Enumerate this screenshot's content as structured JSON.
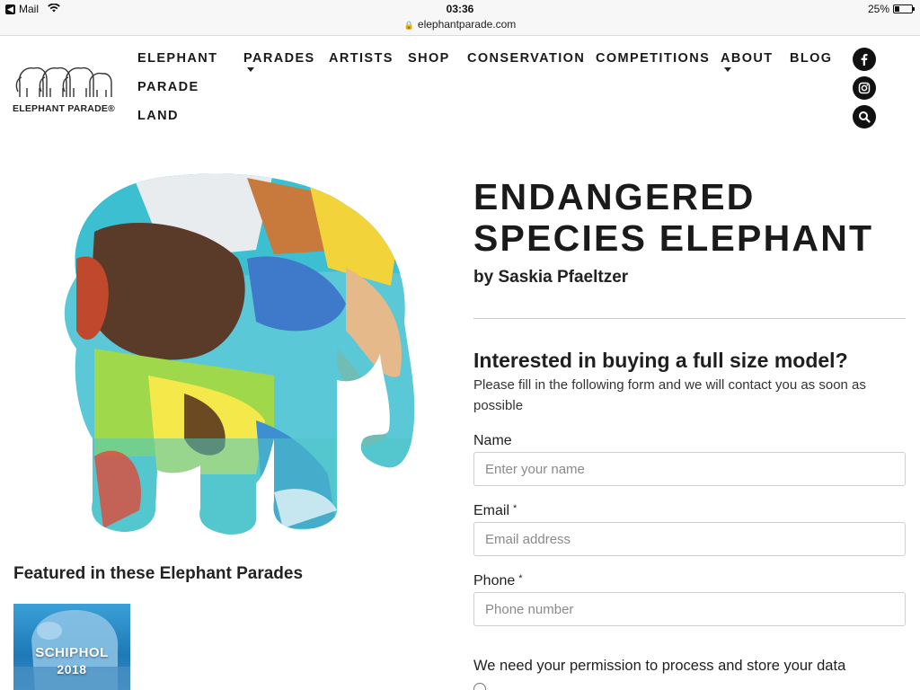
{
  "statusbar": {
    "back_app": "Mail",
    "time": "03:36",
    "url": "elephantparade.com",
    "battery": "25%",
    "battery_level": 0.25
  },
  "logo": {
    "text": "ELEPHANT PARADE®"
  },
  "nav": {
    "items": [
      {
        "label": "ELEPHANT",
        "caret": false
      },
      {
        "label": "PARADE",
        "caret": false
      },
      {
        "label": "LAND",
        "caret": false
      },
      {
        "label": "PARADES",
        "caret": true
      },
      {
        "label": "ARTISTS",
        "caret": false
      },
      {
        "label": "SHOP",
        "caret": false
      },
      {
        "label": "CONSERVATION",
        "caret": false
      },
      {
        "label": "COMPETITIONS",
        "caret": false
      },
      {
        "label": "ABOUT",
        "caret": true
      },
      {
        "label": "BLOG",
        "caret": false
      }
    ]
  },
  "social": {
    "facebook_icon": "f",
    "instagram_icon": "instagram",
    "search_icon": "search"
  },
  "product": {
    "title_line1": "ENDANGERED",
    "title_line2": "SPECIES ELEPHANT",
    "artist": "by Saskia Pfaeltzer"
  },
  "featured": {
    "title": "Featured in these Elephant Parades",
    "parade_line1": "SCHIPHOL",
    "parade_line2": "2018"
  },
  "form": {
    "heading": "Interested in buying a full size model?",
    "intro": "Please fill in the following form and we will contact you as soon as possible",
    "name_label": "Name",
    "name_placeholder": "Enter your name",
    "email_label": "Email",
    "email_placeholder": "Email address",
    "phone_label": "Phone",
    "phone_placeholder": "Phone number",
    "required_mark": "*",
    "permission": "We need your permission to process and store your data"
  },
  "colors": {
    "text": "#1a1a1a",
    "social_bg": "#111111",
    "divider": "#c9c9c9"
  }
}
